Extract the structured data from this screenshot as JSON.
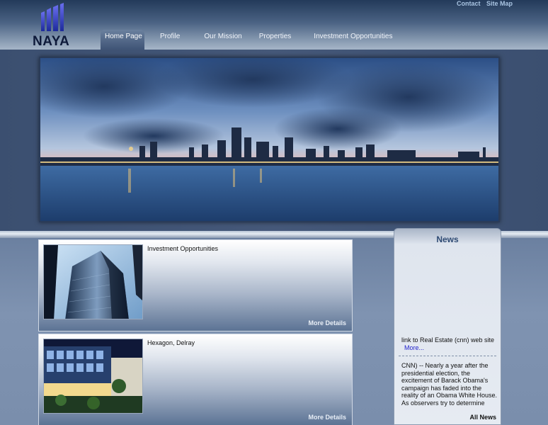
{
  "brand": {
    "name": "NAYA"
  },
  "top_links": {
    "contact": "Contact",
    "sitemap": "Site Map"
  },
  "nav": {
    "items": [
      {
        "label": "Home Page",
        "active": true
      },
      {
        "label": "Profile"
      },
      {
        "label": "Our Mission"
      },
      {
        "label": "Properties"
      },
      {
        "label": "Investment Opportunities"
      }
    ]
  },
  "cards": [
    {
      "title": "Investment Opportunities",
      "more": "More Details"
    },
    {
      "title": "Hexagon, Delray",
      "more": "More Details"
    }
  ],
  "news": {
    "title": "News",
    "link_text": "link to Real Estate (cnn) web site",
    "more": "More...",
    "body": "CNN) -- Nearly a year after the presidential election, the excitement of Barack Obama's campaign has faded into the reality of an Obama White House. As observers try to determine what time it is in American politics, they arrive at opposite",
    "all_news": "All News"
  },
  "colors": {
    "header_dark": "#233a5a",
    "accent_link": "#a9c4e2",
    "news_title": "#2e4a73"
  }
}
